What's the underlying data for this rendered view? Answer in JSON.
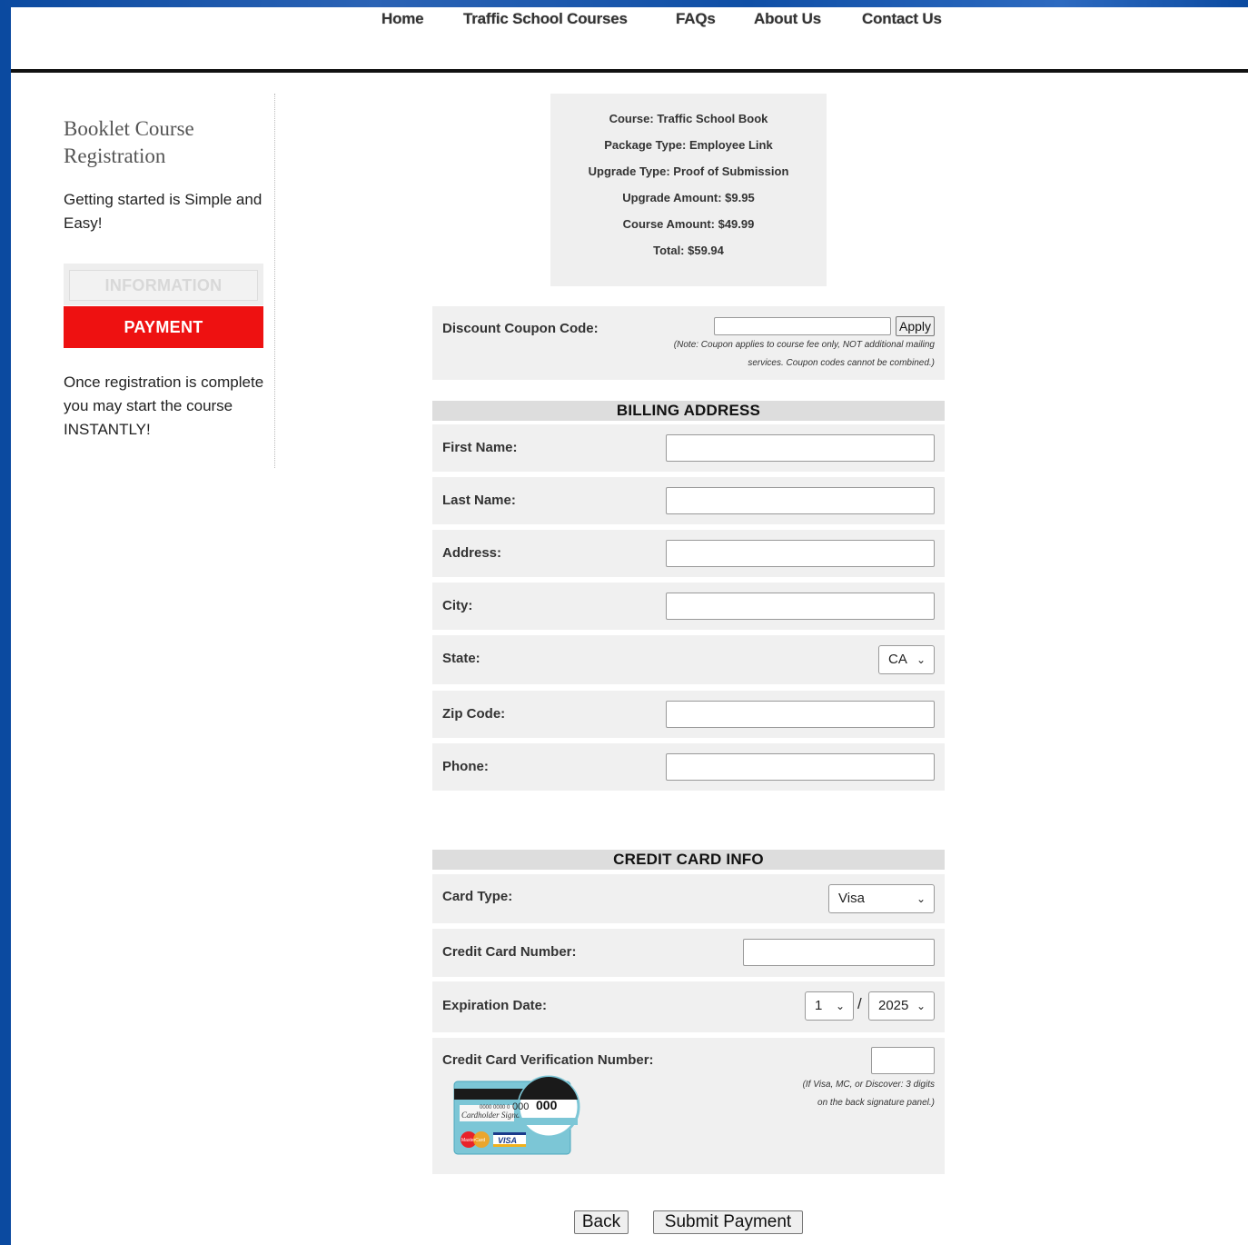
{
  "nav": {
    "items": [
      "Home",
      "Traffic School Courses",
      "FAQs",
      "About Us",
      "Contact Us"
    ]
  },
  "sidebar": {
    "title": "Booklet Course Registration",
    "subtitle": "Getting started is Simple and Easy!",
    "step_information": "INFORMATION",
    "step_payment": "PAYMENT",
    "note": "Once registration is complete you may start the course INSTANTLY!"
  },
  "summary": {
    "course": "Course: Traffic School Book",
    "package_type": "Package Type: Employee Link",
    "upgrade_type": "Upgrade Type: Proof of Submission",
    "upgrade_amount": "Upgrade Amount: $9.95",
    "course_amount": "Course Amount: $49.99",
    "total": "Total: $59.94"
  },
  "coupon": {
    "label": "Discount Coupon Code:",
    "value": "",
    "apply_label": "Apply",
    "note_line1": "(Note: Coupon applies to course fee only, NOT additional mailing",
    "note_line2": "services. Coupon codes cannot be combined.)"
  },
  "billing": {
    "heading": "BILLING ADDRESS",
    "first_name_label": "First Name:",
    "last_name_label": "Last Name:",
    "address_label": "Address:",
    "city_label": "City:",
    "state_label": "State:",
    "state_value": "CA",
    "zip_label": "Zip Code:",
    "phone_label": "Phone:"
  },
  "card": {
    "heading": "CREDIT CARD INFO",
    "type_label": "Card Type:",
    "type_value": "Visa",
    "number_label": "Credit Card Number:",
    "expiration_label": "Expiration Date:",
    "exp_month": "1",
    "exp_separator": "/",
    "exp_year": "2025",
    "cvv_label": "Credit Card Verification Number:",
    "cvv_note_line1": "(If Visa, MC, or Discover: 3 digits",
    "cvv_note_line2": "on the back signature panel.)",
    "illustration": {
      "digits_small": "0000 0000 0",
      "digits_big": "000",
      "digits_pre": "000",
      "signature": "Cardholder Signature",
      "mastercard": "MasterCard",
      "visa": "VISA"
    }
  },
  "buttons": {
    "back": "Back",
    "submit": "Submit Payment"
  },
  "colors": {
    "frame_blue": "#0b4aa0",
    "payment_red": "#ee1111",
    "panel_gray": "#f0f0f0",
    "header_gray": "#dddddd"
  }
}
